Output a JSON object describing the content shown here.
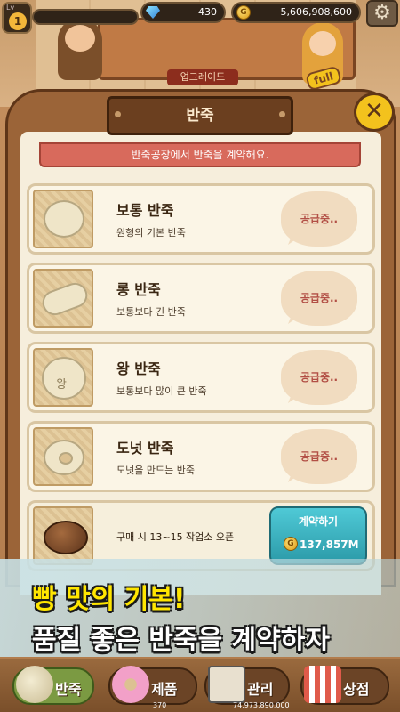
{
  "hud": {
    "level_tag": "Lv",
    "level": "1",
    "gems": "430",
    "gold": "5,606,908,600"
  },
  "background": {
    "upgrade_label": "업그레이드",
    "full_badge": "full"
  },
  "modal": {
    "title": "반죽",
    "banner": "반죽공장에서 반죽을 계약해요.",
    "close_icon": "close-icon",
    "items": [
      {
        "name": "보통 반죽",
        "desc": "원형의 기본 반죽",
        "status": "공급중.."
      },
      {
        "name": "롱 반죽",
        "desc": "보통보다 긴 반죽",
        "status": "공급중.."
      },
      {
        "name": "왕 반죽",
        "desc": "보통보다 많이 큰 반죽",
        "status": "공급중..",
        "stamp": "왕"
      },
      {
        "name": "도넛 반죽",
        "desc": "도넛을 만드는 반죽",
        "status": "공급중.."
      }
    ],
    "locked_item": {
      "desc": "구매 시 13~15 작업소 오픈",
      "button_label": "계약하기",
      "price": "137,857M"
    }
  },
  "promo": {
    "line1": "빵 맛의 기본!",
    "line2": "품질 좋은 반죽을 계약하자"
  },
  "bottom_nav": {
    "items": [
      {
        "label": "반죽",
        "icon": "dough-icon",
        "active": true
      },
      {
        "label": "제품",
        "icon": "donut-icon",
        "active": false
      },
      {
        "label": "관리",
        "icon": "ledger-icon",
        "active": false
      },
      {
        "label": "상점",
        "icon": "shop-icon",
        "active": false
      }
    ],
    "mini_gems": "370",
    "mini_gold": "74,973,890,000"
  },
  "colors": {
    "modal_frame": "#9b6438",
    "banner_red": "#d86a5c",
    "status_text": "#b24f45",
    "buy_button": "#2b9aa8",
    "promo_yellow": "#ffe600"
  }
}
